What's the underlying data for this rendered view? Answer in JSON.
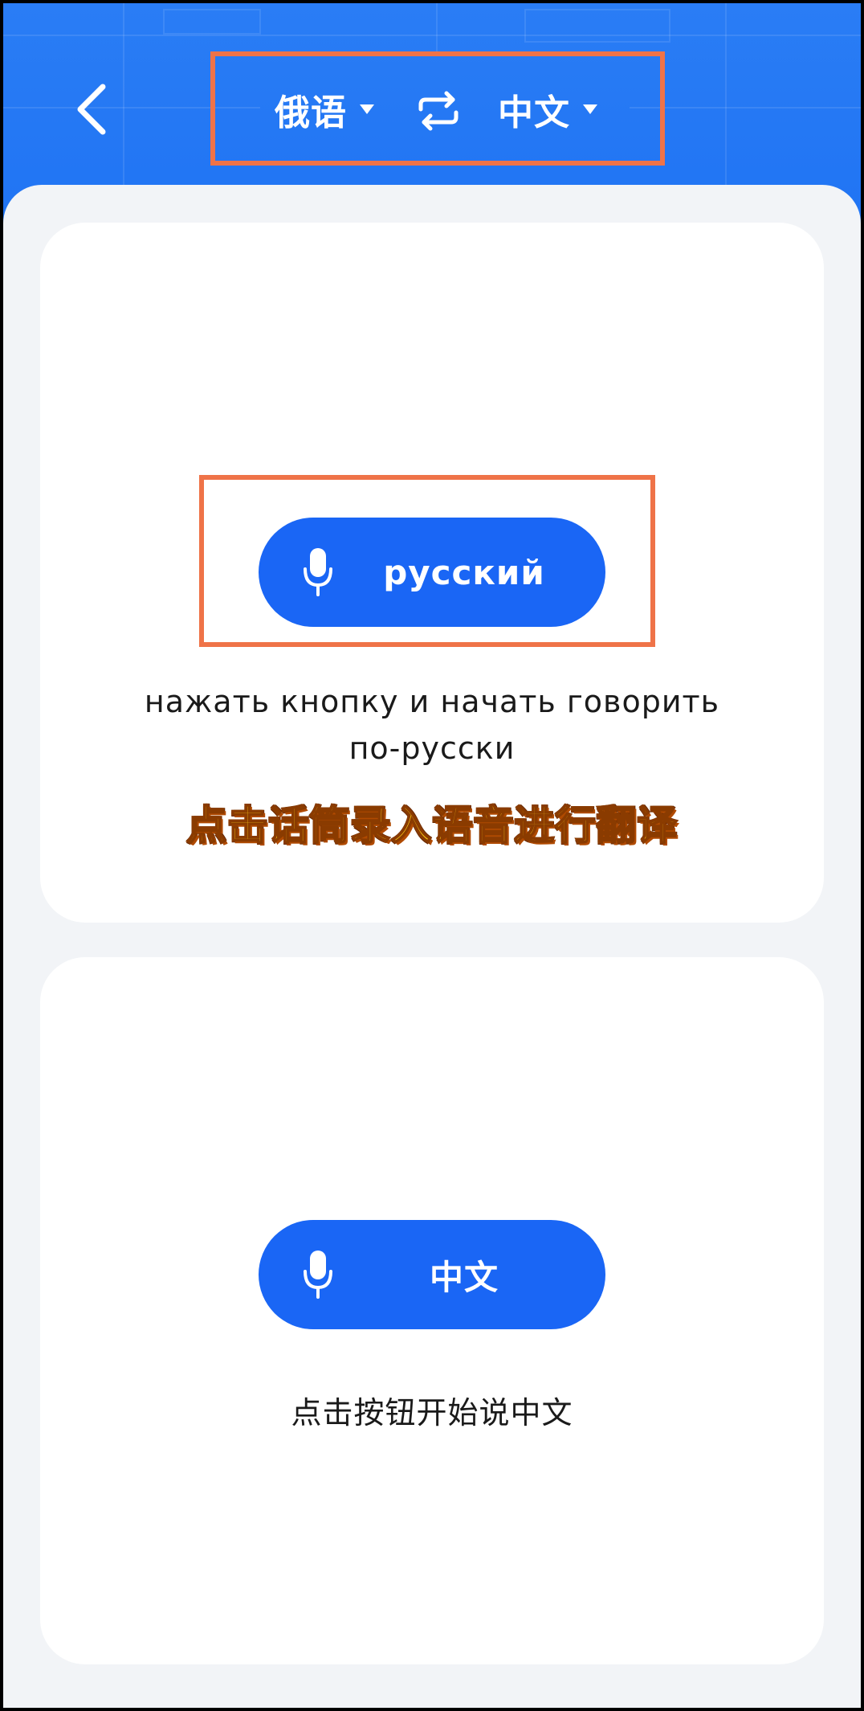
{
  "header": {
    "source_language": "俄语",
    "target_language": "中文",
    "icons": {
      "back": "chevron-left-icon",
      "swap": "swap-icon",
      "caret": "caret-down-icon"
    }
  },
  "source_panel": {
    "mic_icon": "microphone-icon",
    "button_label": "русский",
    "hint": "нажать кнопку и начать говорить\nпо-русски",
    "overlay_caption": "点击话筒录入语音进行翻译"
  },
  "target_panel": {
    "mic_icon": "microphone-icon",
    "button_label": "中文",
    "hint": "点击按钮开始说中文"
  },
  "colors": {
    "header_blue": "#1f73f3",
    "button_blue": "#1a66f5",
    "highlight_orange": "#ef7348",
    "background": "#f2f4f7"
  }
}
